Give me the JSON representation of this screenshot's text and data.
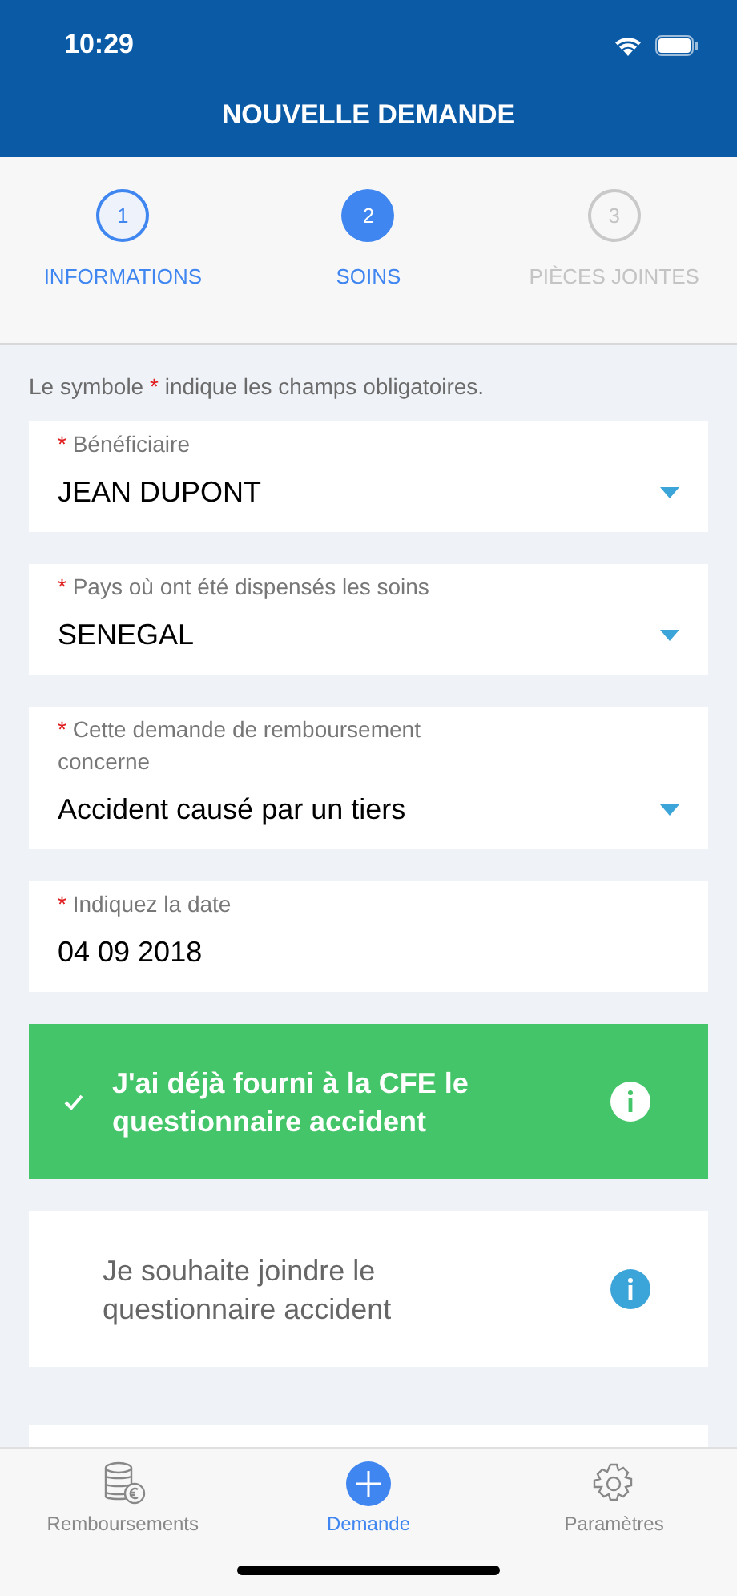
{
  "status_bar": {
    "time": "10:29"
  },
  "header": {
    "title": "NOUVELLE DEMANDE"
  },
  "steps": [
    {
      "number": "1",
      "label": "INFORMATIONS",
      "completed": true,
      "selected": false
    },
    {
      "number": "2",
      "label": "SOINS",
      "completed": false,
      "selected": true
    },
    {
      "number": "3",
      "label": "PIÈCES JOINTES",
      "completed": false,
      "selected": false
    }
  ],
  "hint": {
    "before": "Le symbole ",
    "mark": "*",
    "after": " indique les champs obligatoires."
  },
  "fields": [
    {
      "kind": "select",
      "required": true,
      "label": "Bénéficiaire",
      "value": "JEAN DUPONT"
    },
    {
      "kind": "select",
      "required": true,
      "label": "Pays où ont été dispensés les soins",
      "value": "SENEGAL"
    },
    {
      "kind": "select",
      "required": true,
      "label": "Cette demande de remboursement concerne",
      "value": "Accident causé par un tiers"
    },
    {
      "kind": "date",
      "required": true,
      "label": "Indiquez la date",
      "value": "04 09 2018"
    }
  ],
  "options": [
    {
      "label": "J'ai déjà fourni à la CFE le questionnaire accident",
      "selected": true
    },
    {
      "label": "Je souhaite joindre le questionnaire accident",
      "selected": false
    }
  ],
  "tabs": [
    {
      "label": "Remboursements",
      "selected": false
    },
    {
      "label": "Demande",
      "selected": true
    },
    {
      "label": "Paramètres",
      "selected": false
    }
  ]
}
